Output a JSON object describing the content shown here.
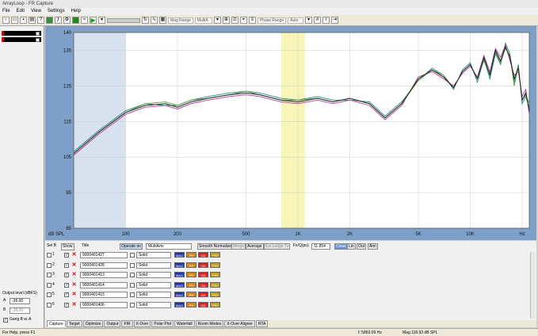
{
  "window": {
    "title": "ArrayLoop - FR Capture"
  },
  "menu": [
    "File",
    "Edit",
    "View",
    "Settings",
    "Help"
  ],
  "toolbar": {
    "mag_range_label": "Mag Range",
    "mag_range_value": "MultiA",
    "phase_range_label": "Phase Range",
    "phase_range_value": "Auto"
  },
  "chart_data": {
    "type": "line",
    "xscale": "log",
    "xlim": [
      50,
      22000
    ],
    "ylim": [
      85,
      140
    ],
    "yticks": [
      85,
      95,
      105,
      115,
      125,
      135,
      140
    ],
    "ytick_labels": [
      "85",
      "95",
      "105",
      "115",
      "125",
      "135",
      "140"
    ],
    "xticks": [
      100,
      200,
      500,
      1000,
      2000,
      5000,
      10000,
      20000
    ],
    "xtick_labels": [
      "100",
      "200",
      "500",
      "1K",
      "2K",
      "5K",
      "10K",
      "Hz"
    ],
    "ylabel": "dB SPL",
    "shaded_bands": [
      {
        "from": 50,
        "to": 100,
        "color": "#d8e2ee"
      },
      {
        "from": 800,
        "to": 1100,
        "color": "#f7f5b8"
      }
    ],
    "series": [
      {
        "color": "#3a4a9c",
        "x": [
          50,
          70,
          100,
          130,
          170,
          200,
          240,
          300,
          400,
          500,
          600,
          800,
          1000,
          1300,
          1600,
          2000,
          2600,
          3200,
          4000,
          5000,
          6000,
          7000,
          8000,
          9000,
          10000,
          11000,
          12000,
          13000,
          14000,
          15000,
          16000,
          17000,
          18000,
          19000,
          20000,
          21000,
          22000
        ],
        "y": [
          106,
          112,
          117.5,
          119.5,
          120,
          119,
          120.5,
          121.5,
          122.5,
          123,
          122.5,
          121,
          120.5,
          121.5,
          120.5,
          121.5,
          120,
          116,
          120,
          127,
          129.5,
          127.5,
          124.5,
          129,
          131,
          127,
          133,
          128,
          135,
          132,
          136,
          133,
          127,
          130,
          121,
          123,
          118
        ]
      },
      {
        "color": "#2a8a7a",
        "x": [
          50,
          70,
          100,
          130,
          170,
          200,
          240,
          300,
          400,
          500,
          600,
          800,
          1000,
          1300,
          1600,
          2000,
          2600,
          3200,
          4000,
          5000,
          6000,
          7000,
          8000,
          9000,
          10000,
          11000,
          12000,
          13000,
          14000,
          15000,
          16000,
          17000,
          18000,
          19000,
          20000,
          21000,
          22000
        ],
        "y": [
          106.5,
          112.5,
          118,
          120,
          119.5,
          119.5,
          121,
          122,
          123,
          123.5,
          123,
          121.5,
          121,
          122,
          121,
          121,
          120.5,
          116.5,
          120.5,
          126.5,
          130,
          128,
          124,
          129.5,
          131.5,
          126,
          132.5,
          127,
          134,
          131,
          137,
          134,
          126,
          131,
          120,
          122,
          119
        ]
      },
      {
        "color": "#b03a9a",
        "x": [
          50,
          70,
          100,
          130,
          170,
          200,
          240,
          300,
          400,
          500,
          600,
          800,
          1000,
          1300,
          1600,
          2000,
          2600,
          3200,
          4000,
          5000,
          6000,
          7000,
          8000,
          9000,
          10000,
          11000,
          12000,
          13000,
          14000,
          15000,
          16000,
          17000,
          18000,
          19000,
          20000,
          21000,
          22000
        ],
        "y": [
          105.5,
          111.5,
          117,
          119,
          119.5,
          118.5,
          120,
          121,
          122,
          122.5,
          122,
          120.5,
          120,
          121,
          120,
          121,
          119.5,
          115.5,
          119.5,
          127.5,
          129,
          127,
          125,
          128.5,
          130.5,
          127.5,
          133.5,
          129,
          135.5,
          133,
          136.5,
          132,
          128,
          129,
          122,
          124,
          117
        ]
      },
      {
        "color": "#5a9a3a",
        "x": [
          50,
          70,
          100,
          130,
          170,
          200,
          240,
          300,
          400,
          500,
          600,
          800,
          1000,
          1300,
          1600,
          2000,
          2600,
          3200,
          4000,
          5000,
          6000,
          7000,
          8000,
          9000,
          10000,
          11000,
          12000,
          13000,
          14000,
          15000,
          16000,
          17000,
          18000,
          19000,
          20000,
          21000,
          22000
        ],
        "y": [
          106,
          112,
          117.5,
          120,
          120.5,
          119.5,
          121,
          121.5,
          122.5,
          123.5,
          122.5,
          121,
          121,
          121.5,
          120.5,
          121.5,
          120,
          116,
          120,
          126.5,
          129.5,
          128,
          124.5,
          129,
          131,
          127,
          132,
          128.5,
          134.5,
          131.5,
          135.5,
          133.5,
          125,
          130.5,
          121,
          122.5,
          120
        ]
      },
      {
        "color": "#202020",
        "x": [
          50,
          70,
          100,
          130,
          170,
          200,
          240,
          300,
          400,
          500,
          600,
          800,
          1000,
          1300,
          1600,
          2000,
          2600,
          3200,
          4000,
          5000,
          6000,
          7000,
          8000,
          9000,
          10000,
          11000,
          12000,
          13000,
          14000,
          15000,
          16000,
          17000,
          18000,
          19000,
          20000,
          21000,
          22000
        ],
        "y": [
          106,
          112,
          117.5,
          119.5,
          120,
          119,
          120.5,
          121.5,
          122.5,
          123,
          122.5,
          121,
          120.5,
          121.5,
          120.5,
          121.5,
          120,
          116,
          120,
          127,
          129.5,
          127.5,
          124.5,
          129,
          131,
          127,
          133,
          128,
          135,
          132,
          136,
          133,
          127,
          130,
          121,
          123,
          118
        ]
      }
    ]
  },
  "controls": {
    "sel_label": "Sel B",
    "show_label": "Show",
    "title_label": "Title",
    "operate_on": "Operate on",
    "multi_arts": "MultiArts",
    "smooth_normalize": "Smooth Normalize",
    "merge": "Merge",
    "average": "Average",
    "ext_ledge": "Ext Ledge Tx",
    "fx_label": "Fx/Q(pu)",
    "fx_value": "11.854",
    "buttons_right": [
      "Close",
      "Lin",
      "Out",
      "Ann"
    ]
  },
  "rows": [
    {
      "n": "1",
      "title": "9000401427",
      "style": "Solid",
      "chips": [
        "MAG",
        "PH",
        "GD",
        "PIG"
      ]
    },
    {
      "n": "2",
      "title": "9000401428",
      "style": "Solid",
      "chips": [
        "MAG",
        "PH",
        "GD",
        "PIG"
      ]
    },
    {
      "n": "3",
      "title": "9000401413",
      "style": "Solid",
      "chips": [
        "MAG",
        "PH",
        "GD",
        "PIG"
      ]
    },
    {
      "n": "4",
      "title": "9000401414",
      "style": "Solid",
      "chips": [
        "MAG",
        "PH",
        "GD",
        "PIG"
      ]
    },
    {
      "n": "5",
      "title": "9000401415",
      "style": "Solid",
      "chips": [
        "MAG",
        "PH",
        "GD",
        "PIG"
      ]
    },
    {
      "n": "6",
      "title": "9000401406",
      "style": "Solid",
      "chips": [
        "MAG",
        "PH",
        "GD",
        "PIG"
      ]
    }
  ],
  "chip_colors": [
    "#2233aa",
    "#d8861a",
    "#d82020",
    "#c0a020"
  ],
  "left_panel": {
    "output_label": "Output level (dBFS)",
    "a_label": "A",
    "a_value": "-36.00",
    "b_label": "B",
    "b_value": "-36.00",
    "gang_label": "Gang B w. A"
  },
  "tabs": [
    {
      "label": "Capture",
      "active": true
    },
    {
      "label": "Target",
      "active": false
    },
    {
      "label": "Optimize",
      "active": false
    },
    {
      "label": "Output",
      "active": false
    },
    {
      "label": "FIR",
      "active": false
    },
    {
      "label": "X-Over",
      "active": false
    },
    {
      "label": "Polar Plot",
      "active": false
    },
    {
      "label": "Waterfall",
      "active": false
    },
    {
      "label": "Room Modes",
      "active": false
    },
    {
      "label": "X-Over Aligner",
      "active": false
    },
    {
      "label": "RTA",
      "active": false
    }
  ],
  "status": {
    "help": "For Help, press F1",
    "freq": "f: 5863.09 Hz",
    "mag": "Mag 118.93 dB SPL"
  }
}
